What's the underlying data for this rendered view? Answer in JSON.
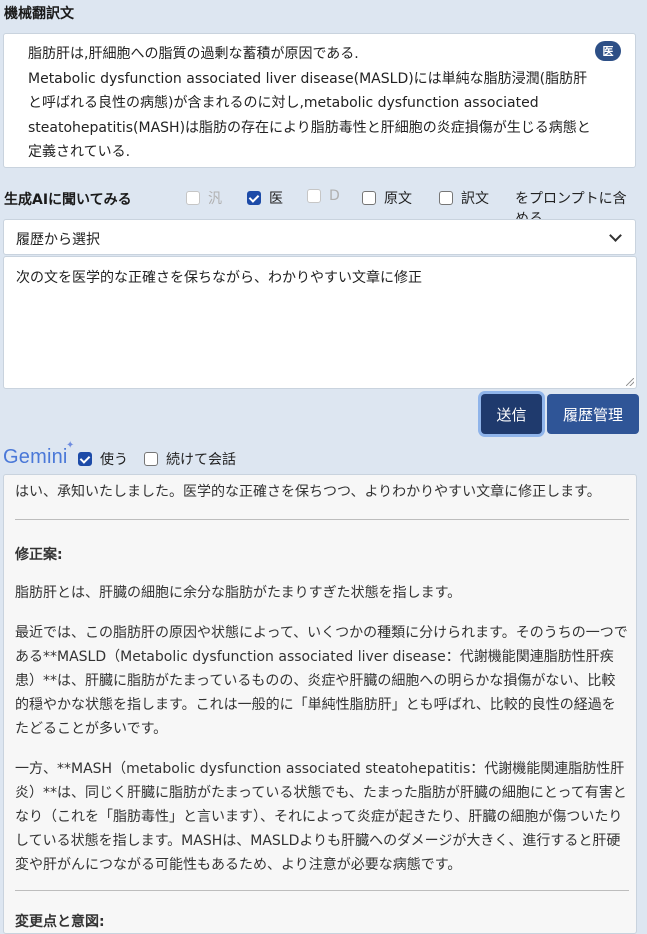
{
  "translation": {
    "title": "機械翻訳文",
    "badge": "医",
    "line1": "脂肪肝は,肝細胞への脂質の過剰な蓄積が原因である.",
    "line2": "Metabolic dysfunction associated liver disease(MASLD)には単純な脂肪浸潤(脂肪肝と呼ばれる良性の病態)が含まれるのに対し,metabolic dysfunction associated steatohepatitis(MASH)は脂肪の存在により脂肪毒性と肝細胞の炎症損傷が生じる病態と定義されている."
  },
  "ai": {
    "title": "生成AIに聞いてみる",
    "options": [
      {
        "label": "汎",
        "checked": false,
        "disabled": true
      },
      {
        "label": "医",
        "checked": true,
        "disabled": false
      },
      {
        "label": "D",
        "checked": false,
        "disabled": true
      },
      {
        "label": "原文",
        "checked": false,
        "disabled": false
      },
      {
        "label": "訳文",
        "checked": false,
        "disabled": false
      }
    ],
    "suffix": "をプロンプトに含める",
    "history_select": "履歴から選択",
    "prompt": "次の文を医学的な正確さを保ちながら、わかりやすい文章に修正",
    "send": "送信",
    "history_manage": "履歴管理"
  },
  "gemini": {
    "logo": "Gemini",
    "use_label": "使う",
    "use_checked": true,
    "continue_label": "続けて会話",
    "continue_checked": false
  },
  "response": {
    "intro": "はい、承知いたしました。医学的な正確さを保ちつつ、よりわかりやすい文章に修正します。",
    "heading1": "修正案:",
    "para1": "脂肪肝とは、肝臓の細胞に余分な脂肪がたまりすぎた状態を指します。",
    "para2": "最近では、この脂肪肝の原因や状態によって、いくつかの種類に分けられます。そのうちの一つである**MASLD（Metabolic dysfunction associated liver disease：代謝機能関連脂肪性肝疾患）**は、肝臓に脂肪がたまっているものの、炎症や肝臓の細胞への明らかな損傷がない、比較的穏やかな状態を指します。これは一般的に「単純性脂肪肝」とも呼ばれ、比較的良性の経過をたどることが多いです。",
    "para3": "一方、**MASH（metabolic dysfunction associated steatohepatitis：代謝機能関連脂肪性肝炎）**は、同じく肝臓に脂肪がたまっている状態でも、たまった脂肪が肝臓の細胞にとって有害となり（これを「脂肪毒性」と言います）、それによって炎症が起きたり、肝臓の細胞が傷ついたりしている状態を指します。MASHは、MASLDよりも肝臓へのダメージが大きく、進行すると肝硬変や肝がんにつながる可能性もあるため、より注意が必要な病態です。",
    "heading2": "変更点と意図:"
  }
}
